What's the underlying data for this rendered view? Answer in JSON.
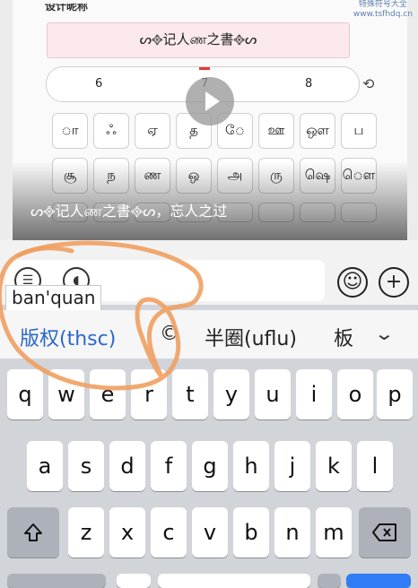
{
  "watermark": {
    "line1": "特殊符号大全",
    "line2": "www.tsfhdq.cn"
  },
  "video": {
    "design_label": "设计昵称",
    "name_preview": "ᔕ᪣记人ண之書᪣ᔕ",
    "counts": [
      "6",
      "7",
      "8"
    ],
    "title": "ᔕ᪣记人ண之書᪣ᔕ，忘人之过",
    "chars_row1": [
      "ா",
      "ஃ",
      "ஏ",
      "த",
      "ே",
      "ஊ",
      "ஔ",
      "ப"
    ],
    "chars_row2": [
      "சூ",
      "ந",
      "ண",
      "ஒ",
      "அ",
      "ரு",
      "ஷெ",
      "ௌ"
    ]
  },
  "input": {
    "pinyin": "ban'quan"
  },
  "candidates": [
    "版权(thsc)",
    "©",
    "半圈(uflu)",
    "板"
  ],
  "keyboard": {
    "row1": [
      "q",
      "w",
      "e",
      "r",
      "t",
      "y",
      "u",
      "i",
      "o",
      "p"
    ],
    "row2": [
      "a",
      "s",
      "d",
      "f",
      "g",
      "h",
      "j",
      "k",
      "l"
    ],
    "row3": [
      "z",
      "x",
      "c",
      "v",
      "b",
      "n",
      "m"
    ]
  },
  "colors": {
    "accent": "#2c68c9",
    "annotation": "#f0a060"
  }
}
